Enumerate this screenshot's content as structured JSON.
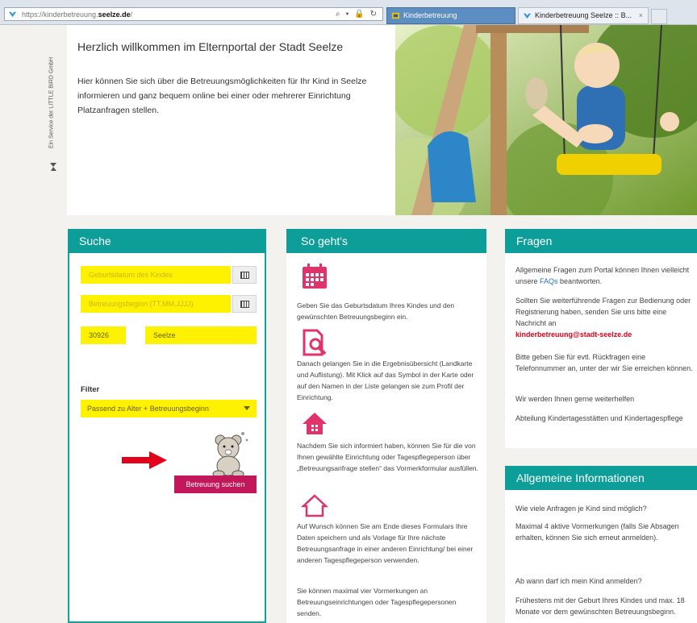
{
  "browser": {
    "url_prefix": "https://",
    "url_path": "kinderbetreuung.",
    "url_domain": "seelze.de",
    "url_suffix": "/",
    "controls": "⌕ ▾ 🔒 ↻",
    "tabs": [
      {
        "label": "Kinderbetreuung"
      },
      {
        "label": "Kinderbetreuung Seelze :: B...",
        "close": "×"
      }
    ]
  },
  "side": {
    "text": "Ein Service der LITTLE BIRD GmbH"
  },
  "hero": {
    "title": "Herzlich willkommen im Elternportal der Stadt Seelze",
    "text": "Hier können Sie sich über die Betreuungsmöglichkeiten für Ihr Kind in Seelze informieren und ganz bequem online bei einer oder mehrerer Einrichtung Platzanfragen stellen."
  },
  "suche": {
    "title": "Suche",
    "birthdate_placeholder": "Geburtsdatum des Kindes",
    "start_placeholder": "Betreuungsbeginn (TT.MM.JJJJ)",
    "plz": "30926",
    "ort": "Seelze",
    "filter_label": "Filter",
    "filter_value": "Passend zu Alter + Betreuungsbeginn",
    "search_button": "Betreuung suchen"
  },
  "so_gehts": {
    "title": "So geht's",
    "steps": [
      {
        "text": "Geben Sie das Geburtsdatum Ihres Kindes und den gewünschten Betreuungsbeginn ein."
      },
      {
        "text": "Danach gelangen Sie in die Ergebnisübersicht (Landkarte und Auflistung). Mit Klick auf das Symbol in der Karte oder auf den Namen in der Liste gelangen sie zum Profil der Einrichtung."
      },
      {
        "text": "Nachdem Sie sich informiert haben, können Sie für die von Ihnen gewählte Einrichtung oder Tagespflegeperson über „Betreuungsanfrage stellen“ das Vormerkformular ausfüllen."
      },
      {
        "text": "Auf Wunsch können Sie am Ende dieses Formulars Ihre Daten speichern und als Vorlage für Ihre nächste Betreuungsanfrage in einer anderen Einrichtung/ bei einer anderen Tagespflegeperson verwenden."
      },
      {
        "text": "Sie können maximal vier Vormerkungen an Betreuungseinrichtungen oder Tagespflegepersonen senden."
      }
    ]
  },
  "fragen": {
    "title": "Fragen",
    "p1_before": "Allgemeine Fragen zum Portal können Ihnen vielleicht unsere ",
    "p1_link": "FAQs",
    "p1_after": " beantworten.",
    "p2": "Sollten Sie weiterführende Fragen zur Bedienung oder Registrierung haben, senden Sie uns bitte eine Nachricht an",
    "email": "kinderbetreuung@stadt-seelze.de",
    "p3": "Bitte geben Sie für evtl. Rückfragen eine Telefonnummer an, unter der wir Sie erreichen können.",
    "p4": "Wir werden Ihnen gerne weiterhelfen",
    "p5": "Abteilung Kindertagesstätten und Kindertagespflege"
  },
  "allgemein": {
    "title": "Allgemeine Informationen",
    "q1": "Wie viele Anfragen je Kind sind möglich?",
    "a1": "Maximal 4 aktive Vormerkungen (falls Sie Absagen erhalten, können Sie sich erneut anmelden).",
    "q2": "Ab wann darf ich mein Kind anmelden?",
    "a2": "Frühestens mit der Geburt Ihres Kindes und max. 18 Monate vor dem gewünschten Betreuungsbeginn."
  },
  "colors": {
    "teal": "#0d9e99",
    "yellow": "#fff200",
    "magenta": "#c2185b",
    "pink_icon": "#e0336b",
    "arrow": "#e3001b"
  }
}
